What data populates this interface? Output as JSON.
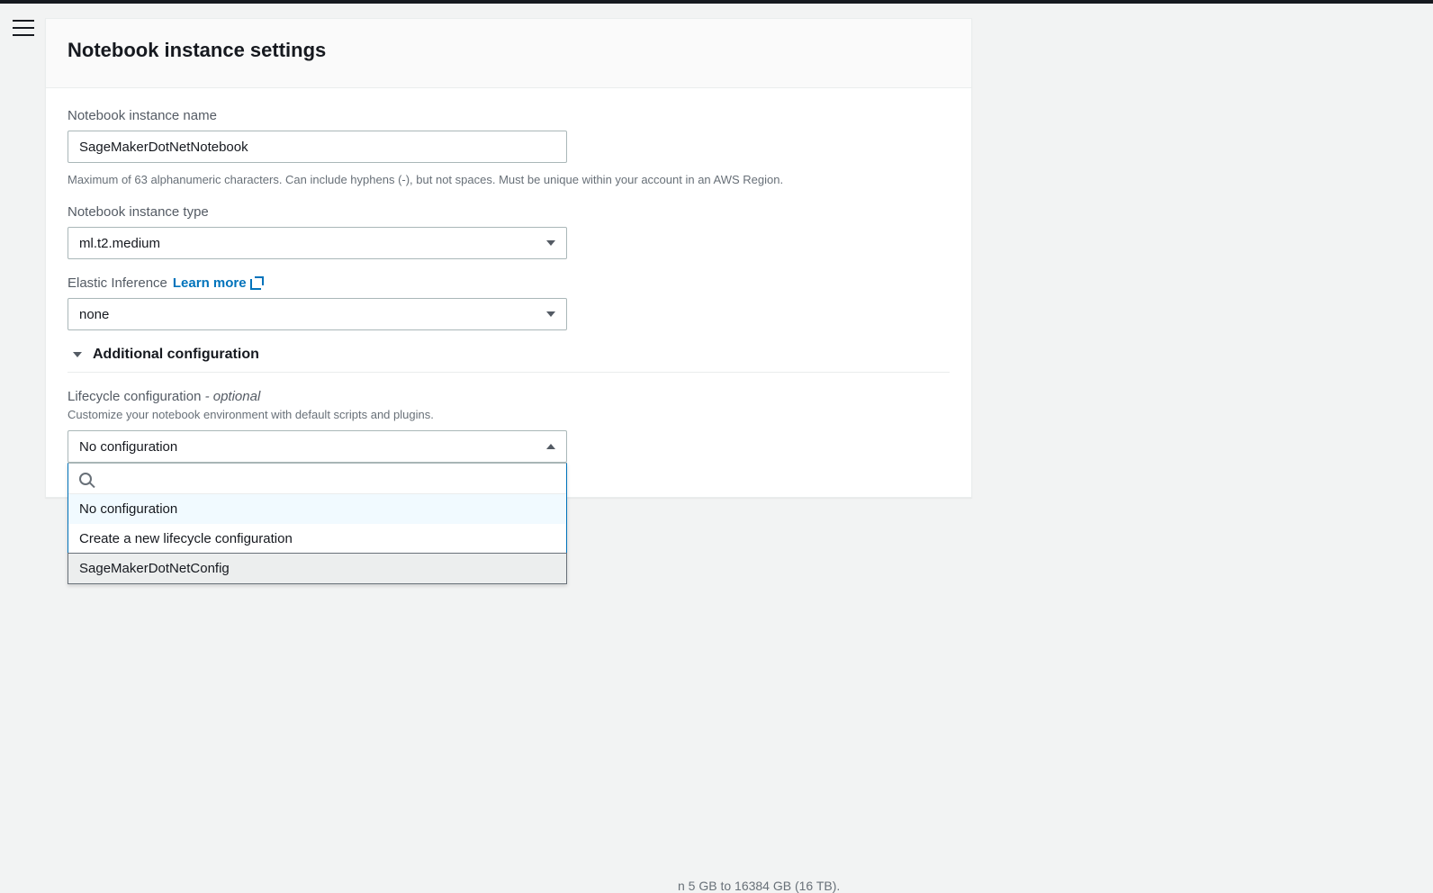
{
  "header": {
    "title": "Notebook instance settings"
  },
  "name_field": {
    "label": "Notebook instance name",
    "value": "SageMakerDotNetNotebook",
    "hint": "Maximum of 63 alphanumeric characters. Can include hyphens (-), but not spaces. Must be unique within your account in an AWS Region."
  },
  "type_field": {
    "label": "Notebook instance type",
    "value": "ml.t2.medium"
  },
  "elastic": {
    "label": "Elastic Inference",
    "link_text": "Learn more",
    "value": "none"
  },
  "additional": {
    "title": "Additional configuration"
  },
  "lifecycle": {
    "label": "Lifecycle configuration",
    "optional": " - optional",
    "hint": "Customize your notebook environment with default scripts and plugins.",
    "value": "No configuration",
    "options": {
      "0": "No configuration",
      "1": "Create a new lifecycle configuration",
      "2": "SageMakerDotNetConfig"
    }
  },
  "volume_hint_fragment": "n 5 GB to 16384 GB (16 TB)."
}
